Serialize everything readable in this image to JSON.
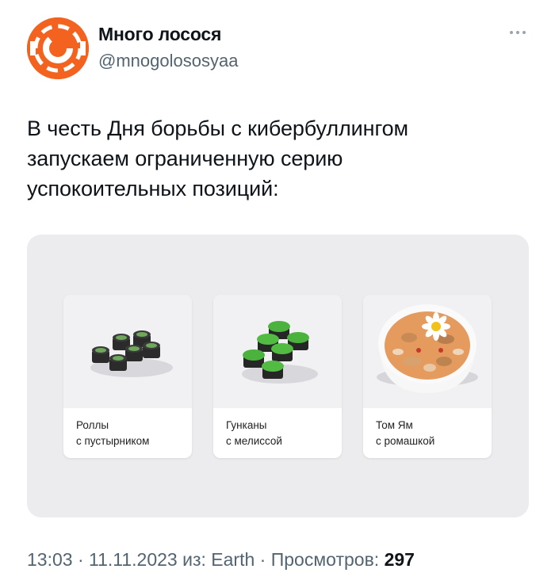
{
  "author": {
    "name": "Много лосося",
    "handle": "@mnogolososyaa",
    "brand_color": "#f4621f"
  },
  "tweet": {
    "lines": [
      "В честь Дня борьбы с кибербуллингом",
      "запускаем ограниченную серию",
      "успокоительных позиций:"
    ]
  },
  "menu_items": [
    {
      "title": "Роллы",
      "subtitle": "с пустырником",
      "image": "rolls-image"
    },
    {
      "title": "Гунканы",
      "subtitle": "с мелиссой",
      "image": "gunkan-image"
    },
    {
      "title": "Том Ям",
      "subtitle": "с ромашкой",
      "image": "tom-yum-image"
    }
  ],
  "meta": {
    "time": "13:03",
    "date": "11.11.2023",
    "source_prefix": "из:",
    "source": "Earth",
    "views_label": "Просмотров:",
    "views_count": "297"
  }
}
